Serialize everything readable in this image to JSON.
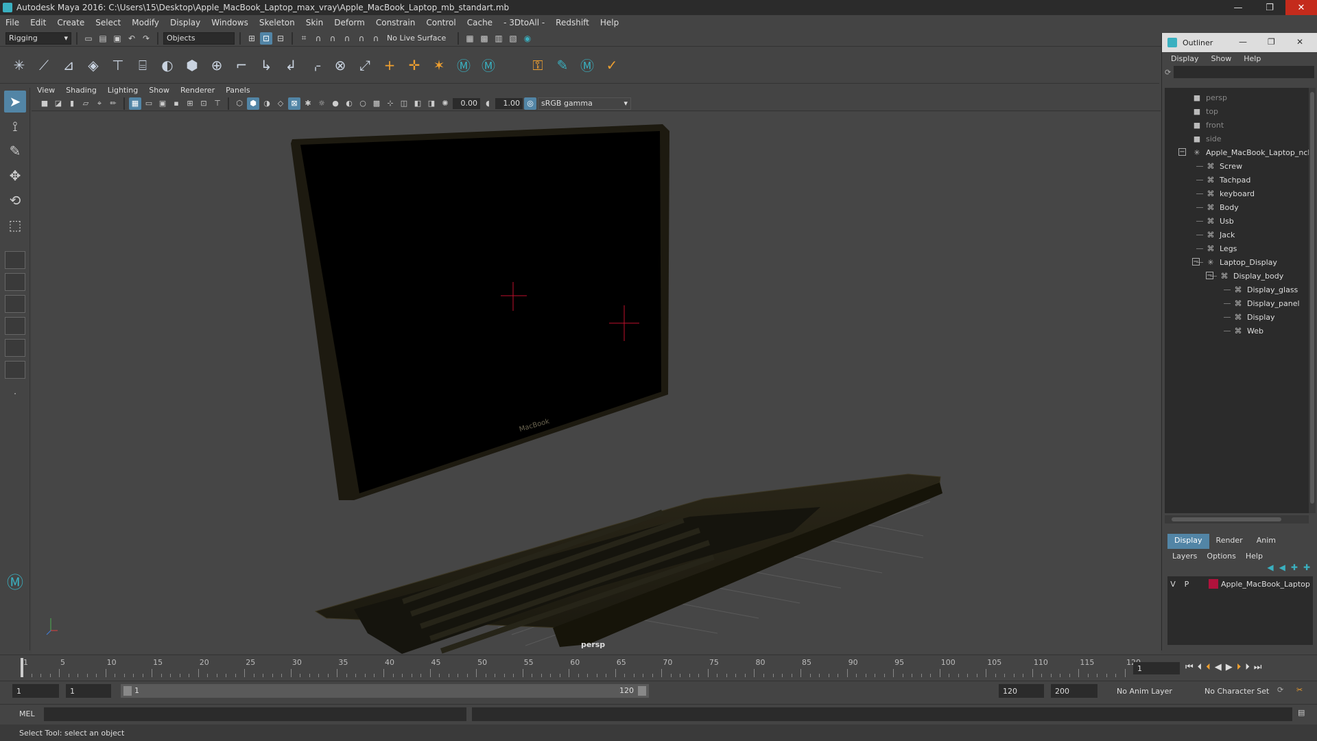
{
  "window": {
    "title": "Autodesk Maya 2016: C:\\Users\\15\\Desktop\\Apple_MacBook_Laptop_max_vray\\Apple_MacBook_Laptop_mb_standart.mb",
    "minimize": "—",
    "restore": "❐",
    "close": "✕"
  },
  "menus": [
    "File",
    "Edit",
    "Create",
    "Select",
    "Modify",
    "Display",
    "Windows",
    "Skeleton",
    "Skin",
    "Deform",
    "Constrain",
    "Control",
    "Cache",
    "- 3DtoAll -",
    "Redshift",
    "Help"
  ],
  "statusline": {
    "menuset": "Rigging",
    "selection_mode": "Objects",
    "live_surface": "No Live Surface"
  },
  "panel": {
    "menus": [
      "View",
      "Shading",
      "Lighting",
      "Show",
      "Renderer",
      "Panels"
    ],
    "exposure": "0.00",
    "gamma": "1.00",
    "color_space": "sRGB gamma",
    "camera_label": "persp",
    "laptop_logo": "MacBook"
  },
  "outliner": {
    "title": "Outliner",
    "menus": [
      "Display",
      "Show",
      "Help"
    ],
    "items": [
      {
        "label": "persp",
        "icon": "camera-icon",
        "depth": 0,
        "dim": true
      },
      {
        "label": "top",
        "icon": "camera-icon",
        "depth": 0,
        "dim": true
      },
      {
        "label": "front",
        "icon": "camera-icon",
        "depth": 0,
        "dim": true
      },
      {
        "label": "side",
        "icon": "camera-icon",
        "depth": 0,
        "dim": true
      },
      {
        "label": "Apple_MacBook_Laptop_ncl",
        "icon": "group-icon",
        "depth": 0,
        "dim": false,
        "expander": "−"
      },
      {
        "label": "Screw",
        "icon": "mesh-icon",
        "depth": 1,
        "dim": false
      },
      {
        "label": "Tachpad",
        "icon": "mesh-icon",
        "depth": 1,
        "dim": false
      },
      {
        "label": "keyboard",
        "icon": "mesh-icon",
        "depth": 1,
        "dim": false
      },
      {
        "label": "Body",
        "icon": "mesh-icon",
        "depth": 1,
        "dim": false
      },
      {
        "label": "Usb",
        "icon": "mesh-icon",
        "depth": 1,
        "dim": false
      },
      {
        "label": "Jack",
        "icon": "mesh-icon",
        "depth": 1,
        "dim": false
      },
      {
        "label": "Legs",
        "icon": "mesh-icon",
        "depth": 1,
        "dim": false
      },
      {
        "label": "Laptop_Display",
        "icon": "group-icon",
        "depth": 1,
        "dim": false,
        "expander": "−"
      },
      {
        "label": "Display_body",
        "icon": "mesh-icon",
        "depth": 2,
        "dim": false,
        "expander": "−"
      },
      {
        "label": "Display_glass",
        "icon": "mesh-icon",
        "depth": 3,
        "dim": false
      },
      {
        "label": "Display_panel",
        "icon": "mesh-icon",
        "depth": 3,
        "dim": false
      },
      {
        "label": "Display",
        "icon": "mesh-icon",
        "depth": 3,
        "dim": false
      },
      {
        "label": "Web",
        "icon": "mesh-icon",
        "depth": 3,
        "dim": false
      }
    ]
  },
  "layers": {
    "tabs": [
      "Display",
      "Render",
      "Anim"
    ],
    "active_tab": "Display",
    "menus": [
      "Layers",
      "Options",
      "Help"
    ],
    "rows": [
      {
        "v": "V",
        "p": "P",
        "name": "Apple_MacBook_Laptop",
        "color": "#b0123c"
      }
    ]
  },
  "timeslider": {
    "labels": [
      "1",
      "5",
      "10",
      "15",
      "20",
      "25",
      "30",
      "35",
      "40",
      "45",
      "50",
      "55",
      "60",
      "65",
      "70",
      "75",
      "80",
      "85",
      "90",
      "95",
      "100",
      "105",
      "110",
      "115",
      "120"
    ],
    "current_frame": "1"
  },
  "range": {
    "start": "1",
    "inner_start": "1",
    "slider_start": "1",
    "slider_end": "120",
    "end": "120",
    "max": "200",
    "anim_layer": "No Anim Layer",
    "character_set": "No Character Set"
  },
  "commandline": {
    "lang": "MEL"
  },
  "helpline": "Select Tool: select an object",
  "colors": {
    "accent": "#5285a6",
    "maya_teal": "#3ab0c0",
    "close_red": "#c42b1c"
  }
}
